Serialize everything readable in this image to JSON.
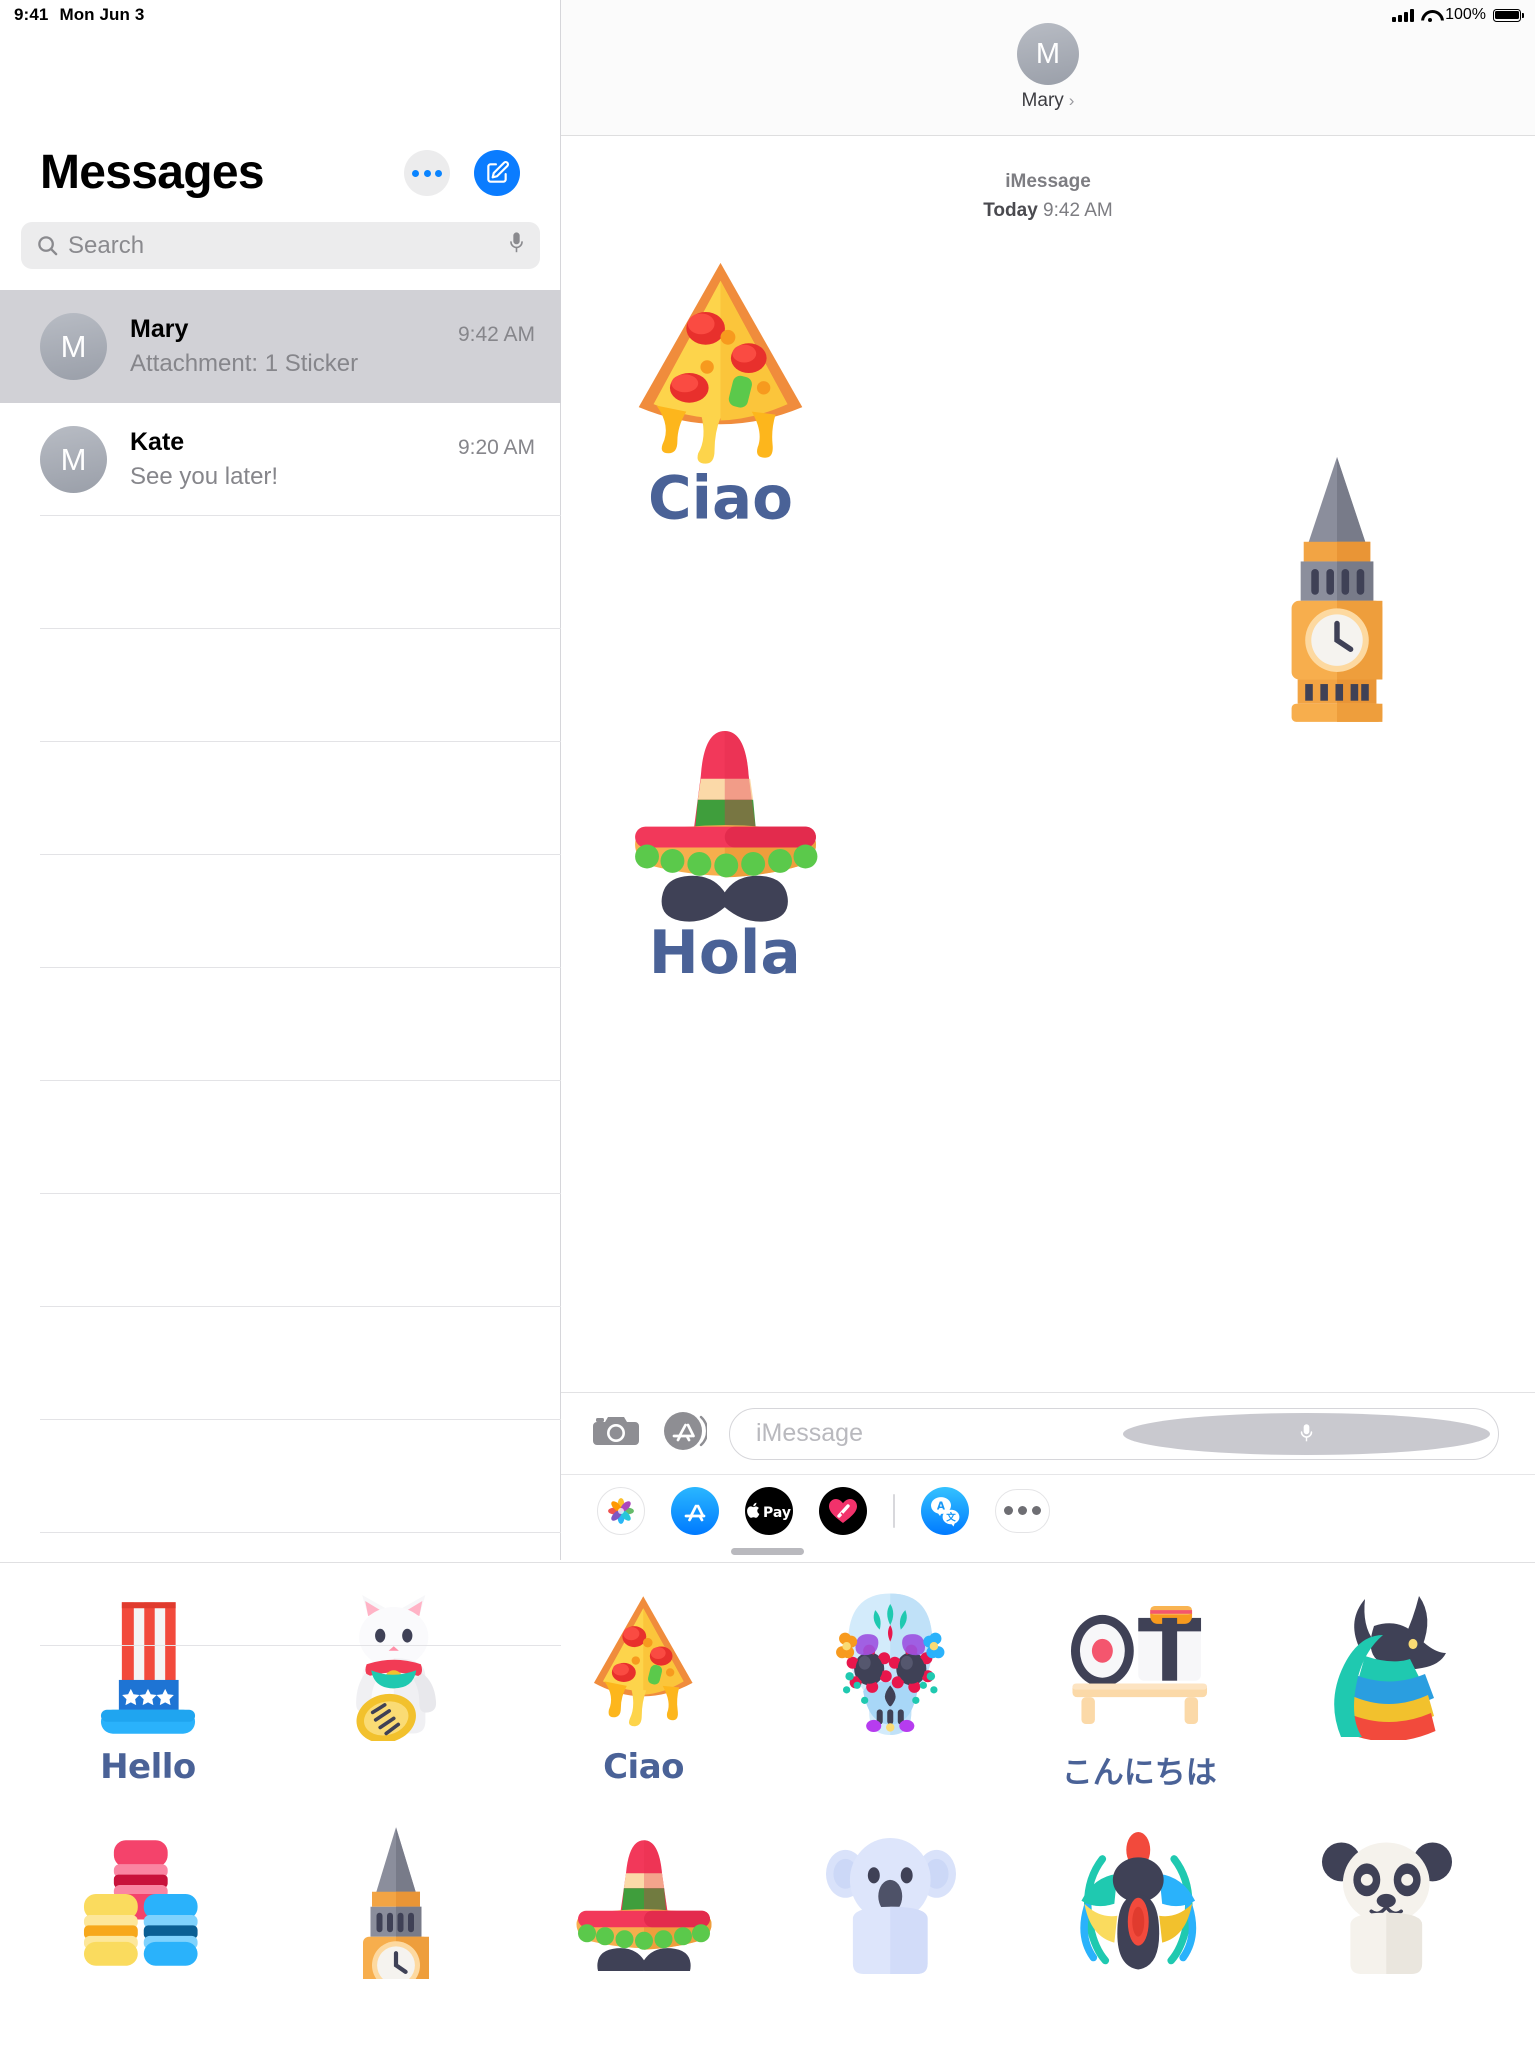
{
  "status_bar": {
    "time": "9:41",
    "date": "Mon Jun 3",
    "battery_percent": "100%",
    "signal_icon": "cellular-signal-icon",
    "wifi_icon": "wifi-icon",
    "battery_icon": "battery-icon"
  },
  "sidebar": {
    "title": "Messages",
    "more_button_icon": "ellipsis-icon",
    "compose_button_icon": "compose-icon",
    "search": {
      "placeholder": "Search",
      "search_icon": "search-icon",
      "dictation_icon": "microphone-icon"
    },
    "conversations": [
      {
        "name": "Mary",
        "preview": "Attachment: 1 Sticker",
        "time": "9:42 AM",
        "avatar_initial": "M",
        "selected": true
      },
      {
        "name": "Kate",
        "preview": "See you later!",
        "time": "9:20 AM",
        "avatar_initial": "M",
        "selected": false
      }
    ]
  },
  "conversation": {
    "header": {
      "name": "Mary",
      "avatar_initial": "M",
      "chevron_icon": "chevron-right-icon"
    },
    "thread_meta": {
      "service": "iMessage",
      "day": "Today",
      "time": "9:42 AM"
    },
    "messages": [
      {
        "type": "sticker",
        "sticker": "pizza",
        "label": "Ciao",
        "align": "left"
      },
      {
        "type": "sticker",
        "sticker": "big-ben",
        "label": "",
        "align": "right"
      },
      {
        "type": "sticker",
        "sticker": "sombrero",
        "label": "Hola",
        "align": "left"
      }
    ]
  },
  "input_bar": {
    "camera_icon": "camera-icon",
    "apps_icon": "app-store-icon",
    "placeholder": "iMessage",
    "dictation_icon": "microphone-icon"
  },
  "app_drawer": {
    "items": [
      {
        "name": "Photos",
        "icon": "photos-icon"
      },
      {
        "name": "App Store",
        "icon": "app-store-icon"
      },
      {
        "name": "Apple Pay",
        "icon": "apple-pay-icon"
      },
      {
        "name": "Digital Touch",
        "icon": "digital-touch-icon"
      },
      {
        "name": "Translate",
        "icon": "translate-icon"
      }
    ],
    "more_icon": "ellipsis-icon"
  },
  "sticker_drawer": {
    "stickers": [
      {
        "id": "uncle-sam-hat",
        "label": "Hello"
      },
      {
        "id": "lucky-cat",
        "label": ""
      },
      {
        "id": "pizza",
        "label": "Ciao"
      },
      {
        "id": "sugar-skull",
        "label": ""
      },
      {
        "id": "sushi",
        "label": "こんにちは"
      },
      {
        "id": "anubis",
        "label": ""
      },
      {
        "id": "macarons",
        "label": ""
      },
      {
        "id": "big-ben",
        "label": ""
      },
      {
        "id": "sombrero",
        "label": ""
      },
      {
        "id": "koala",
        "label": ""
      },
      {
        "id": "scarab",
        "label": ""
      },
      {
        "id": "panda",
        "label": ""
      }
    ]
  },
  "colors": {
    "accent_blue": "#0a7cff",
    "sticker_label_blue": "#4a6297",
    "selected_row": "#d1d1d6"
  }
}
